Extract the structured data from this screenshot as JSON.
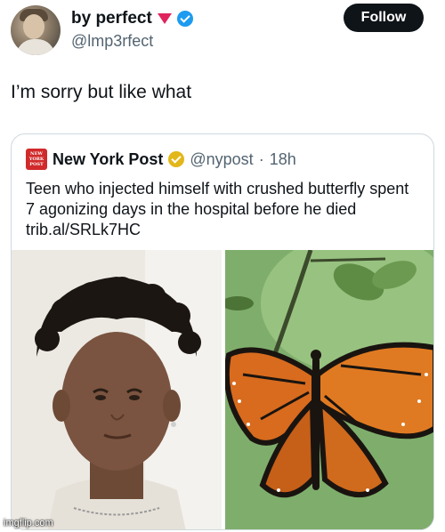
{
  "user": {
    "display_name": "by perfect",
    "handle": "@lmp3rfect",
    "follow_label": "Follow"
  },
  "tweet": {
    "text": "I’m sorry but like what"
  },
  "quoted": {
    "logo_text_1": "NEW",
    "logo_text_2": "YORK",
    "logo_text_3": "POST",
    "name": "New York Post",
    "handle": "@nypost",
    "separator": "·",
    "time": "18h",
    "text": "Teen who injected himself with crushed butterfly spent 7 agonizing days in the hospital before he died trib.al/SRLk7HC"
  },
  "watermark": "imgflip.com",
  "colors": {
    "verified_blue": "#1d9bf0",
    "gold_badge": "#e2b719",
    "nyp_red": "#d12a2a",
    "follow_bg": "#0f1419"
  }
}
